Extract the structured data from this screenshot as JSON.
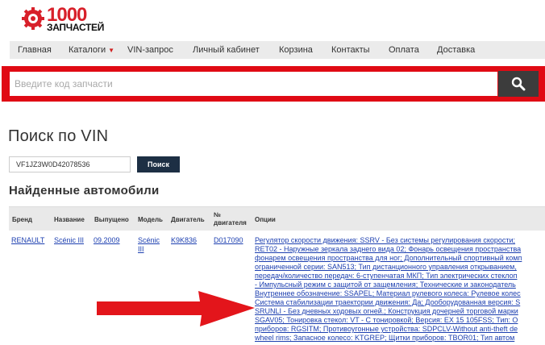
{
  "logo": {
    "number": "1000",
    "subtitle": "ЗАПЧАСТЕЙ"
  },
  "nav": {
    "items": [
      {
        "label": "Главная"
      },
      {
        "label": "Каталоги",
        "has_dropdown": true
      },
      {
        "label": "VIN-запрос"
      },
      {
        "label": "Личный кабинет"
      },
      {
        "label": "Корзина"
      },
      {
        "label": "Контакты"
      },
      {
        "label": "Оплата"
      },
      {
        "label": "Доставка"
      }
    ]
  },
  "search": {
    "placeholder": "Введите код запчасти",
    "icon": "magnifier-icon"
  },
  "page": {
    "title": "Поиск по VIN"
  },
  "vin_form": {
    "value": "VF1JZ3W0D42078536",
    "button_label": "Поиск"
  },
  "results": {
    "title": "Найденные автомобили",
    "headers": [
      "Бренд",
      "Название",
      "Выпущено",
      "Модель",
      "Двигатель",
      "№ двигателя",
      "Опции"
    ],
    "rows": [
      {
        "brand": "RENAULT",
        "name": "Scénic III",
        "released": "09.2009",
        "model": "Scénic III",
        "engine": "K9K836",
        "engine_no": "D017090",
        "options": [
          "Регулятор скорости движения: SSRV - Без системы регулирования скорости;",
          "RET02 - Наружные зеркала заднего вида 02; Фонарь освещения пространства",
          "фонарем освещения пространства для ног; Дополнительный спортивный комп",
          "ограниченной серии: SAN513; Тип дистанционного управления открыванием,",
          "передач/количество передач: 6-ступенчатая МКП; Тип электрических стеклоп",
          "- Импульсный режим с защитой от защемления; Технические и законодатель",
          "Внутреннее обозначение:  SSAPEL; Материал рулевого колеса: Рулевое колес",
          "Система стабилизации траектории движения: Да; Дооборудованная версия: S",
          "SRUNLI - Без дневных ходовых огней.; Конструкция дочерней торговой марки",
          "SGAV05; Тонировка стекол: VT - С тонировкой; Версия: EX 15 105FSS; Тип: О",
          "приборов: RGSITM; Противоугонные устройства: SDPCLV-Without anti-theft de",
          "wheel rims; Запасное колесо: KTGREP; Щитки приборов: TBOR01; Тип автом"
        ]
      }
    ]
  },
  "colors": {
    "brand_red": "#e00a14",
    "link_blue": "#1c3fb0",
    "button_dark": "#1d2f44"
  }
}
